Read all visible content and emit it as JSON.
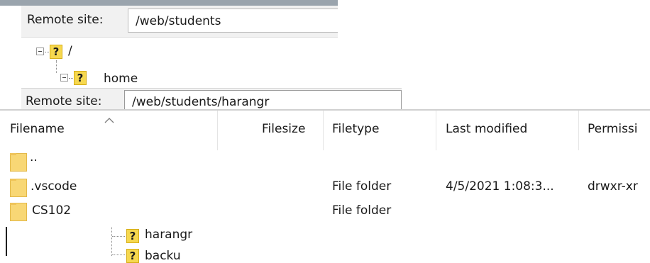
{
  "remote_top": {
    "label": "Remote site:",
    "path": "/web/students"
  },
  "tree": {
    "root_label": "/",
    "home_label": "home",
    "user_label": "harangr",
    "partial_label": "backu"
  },
  "remote_second": {
    "label": "Remote site:",
    "path": "/web/students/harangr"
  },
  "filelist": {
    "columns": {
      "filename": "Filename",
      "filesize": "Filesize",
      "filetype": "Filetype",
      "last_modified": "Last modified",
      "permissions": "Permissi"
    },
    "rows": [
      {
        "name": "..",
        "filesize": "",
        "filetype": "",
        "last_modified": "",
        "permissions": ""
      },
      {
        "name": ".vscode",
        "filesize": "",
        "filetype": "File folder",
        "last_modified": "4/5/2021 1:08:3...",
        "permissions": "drwxr-xr"
      },
      {
        "name": "CS102",
        "filesize": "",
        "filetype": "File folder",
        "last_modified": "",
        "permissions": ""
      }
    ]
  },
  "icons": {
    "unknown": "question-icon",
    "folder": "folder-icon",
    "expander": "tree-collapse-icon",
    "sort": "sort-ascending-icon"
  },
  "colors": {
    "folder": "#f8d775",
    "question_icon_bg": "#f6d84f",
    "bar_bg": "#f1f1f1",
    "header_separator": "#e4e4e4"
  }
}
